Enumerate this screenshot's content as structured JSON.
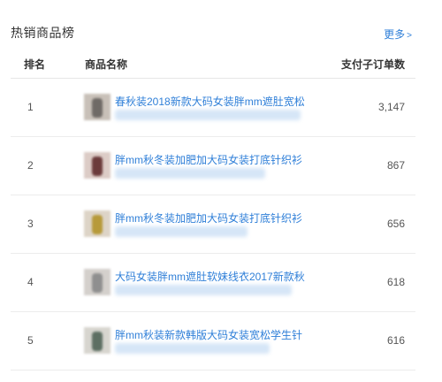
{
  "panel": {
    "title": "热销商品榜",
    "more_label": "更多",
    "more_arrow": ">"
  },
  "table": {
    "headers": {
      "rank": "排名",
      "name": "商品名称",
      "count": "支付子订单数"
    },
    "rows": [
      {
        "rank": "1",
        "title": "春秋装2018新款大码女装胖mm遮肚宽松",
        "count": "3,147",
        "thumb_color": "#c8c0b8",
        "fig_color": "#6f6a66"
      },
      {
        "rank": "2",
        "title": "胖mm秋冬装加肥加大码女装打底针织衫",
        "count": "867",
        "thumb_color": "#dcccc6",
        "fig_color": "#6b3b3b"
      },
      {
        "rank": "3",
        "title": "胖mm秋冬装加肥加大码女装打底针织衫",
        "count": "656",
        "thumb_color": "#ddd4c7",
        "fig_color": "#b79a3a"
      },
      {
        "rank": "4",
        "title": "大码女装胖mm遮肚软妹线衣2017新款秋",
        "count": "618",
        "thumb_color": "#d4d0cc",
        "fig_color": "#8f8f8f"
      },
      {
        "rank": "5",
        "title": "胖mm秋装新款韩版大码女装宽松学生针",
        "count": "616",
        "thumb_color": "#d7d5cf",
        "fig_color": "#5d6f63"
      }
    ]
  }
}
